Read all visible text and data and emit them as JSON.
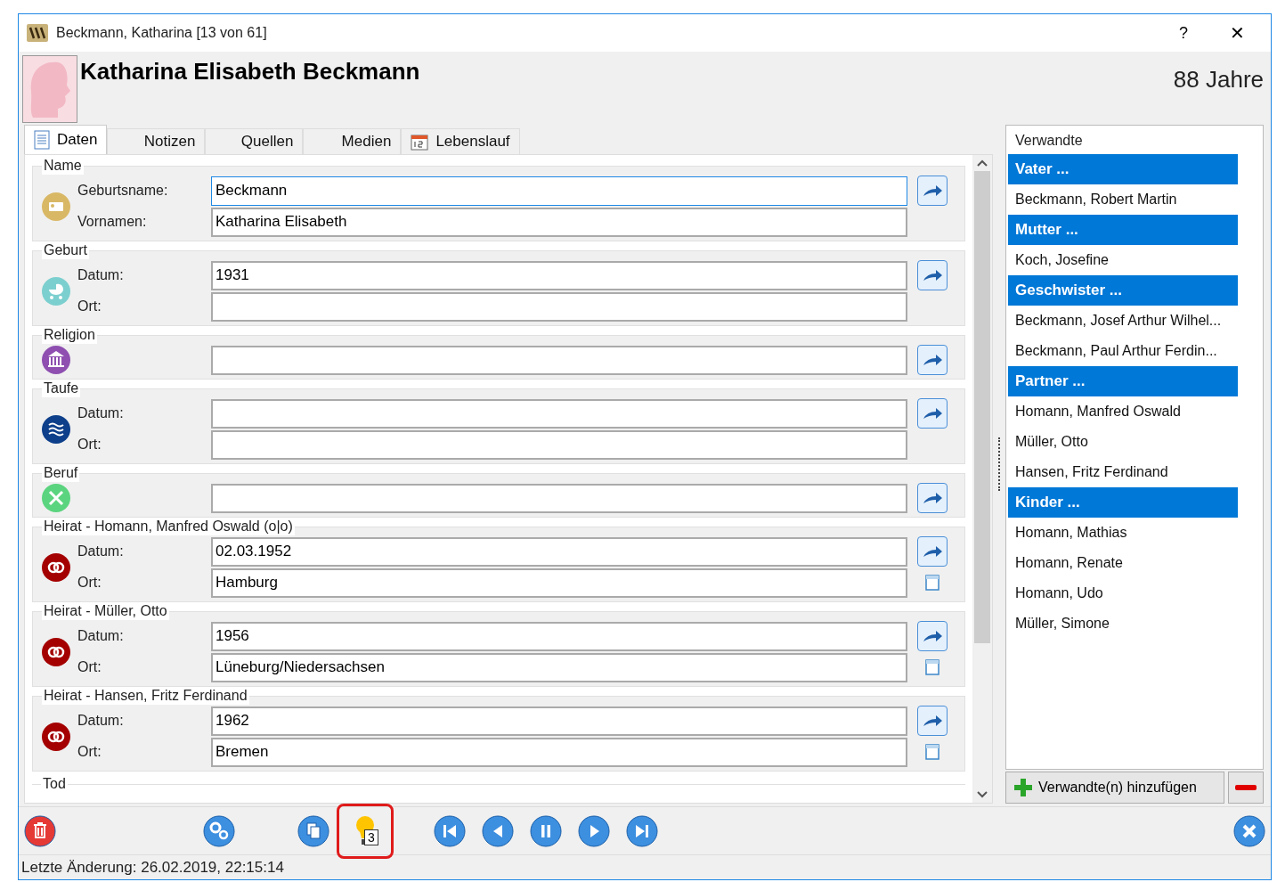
{
  "window": {
    "title": "Beckmann, Katharina [13 von 61]",
    "help": "?",
    "close": "✕"
  },
  "header": {
    "name": "Katharina Elisabeth Beckmann",
    "age": "88 Jahre"
  },
  "tabs": [
    {
      "label": "Daten",
      "selected": true
    },
    {
      "label": "Notizen",
      "selected": false
    },
    {
      "label": "Quellen",
      "selected": false
    },
    {
      "label": "Medien",
      "selected": false
    },
    {
      "label": "Lebenslauf",
      "selected": false
    }
  ],
  "sections": [
    {
      "title": "Name",
      "kind": "name",
      "rows": [
        {
          "label": "Geburtsname:",
          "value": "Beckmann",
          "focused": true
        },
        {
          "label": "Vornamen:",
          "value": "Katharina Elisabeth"
        }
      ]
    },
    {
      "title": "Geburt",
      "kind": "birth",
      "rows": [
        {
          "label": "Datum:",
          "value": "1931"
        },
        {
          "label": "Ort:"
        }
      ]
    },
    {
      "title": "Religion",
      "kind": "religion",
      "rows": [
        {}
      ]
    },
    {
      "title": "Taufe",
      "kind": "baptism",
      "rows": [
        {
          "label": "Datum:"
        },
        {
          "label": "Ort:"
        }
      ]
    },
    {
      "title": "Beruf",
      "kind": "occupation",
      "rows": [
        {}
      ]
    },
    {
      "title": "Heirat - Homann, Manfred Oswald (o|o)",
      "kind": "marriage",
      "source": true,
      "rows": [
        {
          "label": "Datum:",
          "value": "02.03.1952"
        },
        {
          "label": "Ort:",
          "value": "Hamburg"
        }
      ]
    },
    {
      "title": "Heirat - Müller, Otto",
      "kind": "marriage",
      "source": true,
      "rows": [
        {
          "label": "Datum:",
          "value": "1956"
        },
        {
          "label": "Ort:",
          "value": "Lüneburg/Niedersachsen"
        }
      ]
    },
    {
      "title": "Heirat - Hansen, Fritz Ferdinand",
      "kind": "marriage",
      "source": true,
      "rows": [
        {
          "label": "Datum:",
          "value": "1962"
        },
        {
          "label": "Ort:",
          "value": "Bremen"
        }
      ]
    },
    {
      "title": "Tod"
    }
  ],
  "relatives": {
    "title": "Verwandte",
    "items": [
      {
        "kind": "header",
        "label": "Vater ..."
      },
      {
        "kind": "person",
        "label": "Beckmann, Robert Martin"
      },
      {
        "kind": "header",
        "label": "Mutter ..."
      },
      {
        "kind": "person",
        "label": "Koch, Josefine"
      },
      {
        "kind": "header",
        "label": "Geschwister ..."
      },
      {
        "kind": "person",
        "label": "Beckmann, Josef Arthur Wilhel..."
      },
      {
        "kind": "person",
        "label": "Beckmann, Paul Arthur Ferdin..."
      },
      {
        "kind": "header",
        "label": "Partner ..."
      },
      {
        "kind": "person",
        "label": "Homann, Manfred Oswald"
      },
      {
        "kind": "person",
        "label": "Müller, Otto"
      },
      {
        "kind": "person",
        "label": "Hansen, Fritz Ferdinand"
      },
      {
        "kind": "header",
        "label": "Kinder ..."
      },
      {
        "kind": "person",
        "label": "Homann, Mathias"
      },
      {
        "kind": "person",
        "label": "Homann, Renate"
      },
      {
        "kind": "person",
        "label": "Homann, Udo"
      },
      {
        "kind": "person",
        "label": "Müller, Simone"
      }
    ],
    "add_button": "Verwandte(n) hinzufügen"
  },
  "toolbar": [
    {
      "kind": "delete"
    },
    {
      "kind": "settings"
    },
    {
      "kind": "copy"
    },
    {
      "kind": "hint",
      "badge": "3",
      "highlighted": true
    },
    {
      "kind": "first"
    },
    {
      "kind": "prev"
    },
    {
      "kind": "pause"
    },
    {
      "kind": "next"
    },
    {
      "kind": "last"
    },
    {
      "kind": "close"
    }
  ],
  "status_bar": "Letzte Änderung: 26.02.2019, 22:15:14"
}
